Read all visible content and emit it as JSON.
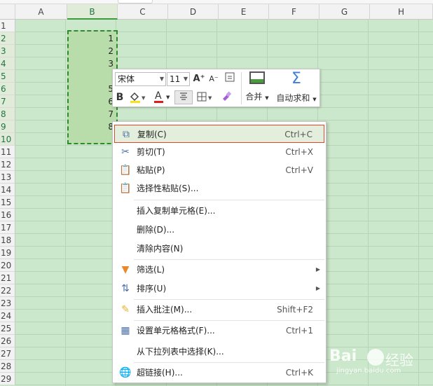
{
  "columns": [
    "A",
    "B",
    "C",
    "D",
    "E",
    "F",
    "G",
    "H"
  ],
  "rows": [
    "1",
    "2",
    "3",
    "4",
    "5",
    "6",
    "7",
    "8",
    "9",
    "10",
    "11",
    "12",
    "13",
    "14",
    "15",
    "16",
    "17",
    "18",
    "19",
    "20",
    "21",
    "22",
    "23",
    "24",
    "25",
    "26",
    "27",
    "28",
    "29"
  ],
  "cells": {
    "b2": "1",
    "b3": "2",
    "b4": "3",
    "b5": "",
    "b6": "5",
    "b7": "6",
    "b8": "7",
    "b9": "8",
    "b10": ""
  },
  "minibar": {
    "font": "宋体",
    "size": "11",
    "bold": "B",
    "font_color": "A",
    "merge_label": "合并",
    "autosum_label": "自动求和",
    "increase_font": "A⁺",
    "decrease_font": "A⁻"
  },
  "menu": {
    "copy": {
      "label": "复制(C)",
      "shortcut": "Ctrl+C"
    },
    "cut": {
      "label": "剪切(T)",
      "shortcut": "Ctrl+X"
    },
    "paste": {
      "label": "粘贴(P)",
      "shortcut": "Ctrl+V"
    },
    "paste_special": {
      "label": "选择性粘贴(S)..."
    },
    "insert_copied": {
      "label": "插入复制单元格(E)..."
    },
    "delete": {
      "label": "删除(D)..."
    },
    "clear": {
      "label": "清除内容(N)"
    },
    "filter": {
      "label": "筛选(L)"
    },
    "sort": {
      "label": "排序(U)"
    },
    "insert_comment": {
      "label": "插入批注(M)...",
      "shortcut": "Shift+F2"
    },
    "format_cells": {
      "label": "设置单元格格式(F)...",
      "shortcut": "Ctrl+1"
    },
    "pick_list": {
      "label": "从下拉列表中选择(K)..."
    },
    "hyperlink": {
      "label": "超链接(H)...",
      "shortcut": "Ctrl+K"
    }
  },
  "watermark": {
    "brand": "Bai",
    "brand2": "经验",
    "url": "jingyan.baidu.com"
  },
  "colors": {
    "grid_bg": "#cce8cc",
    "selection_border": "#2f8a2f",
    "highlight_border": "#d9482a"
  }
}
